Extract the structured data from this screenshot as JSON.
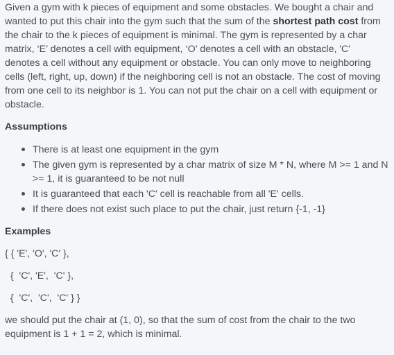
{
  "intro": {
    "part1": "Given a gym with k pieces of equipment and some obstacles.  We bought a chair and wanted to put this chair into the gym such that  the sum of the ",
    "bold": "shortest path cost",
    "part2": " from the chair to the k pieces of equipment is minimal. The gym is represented by a char matrix,  ‘E’  denotes a cell with equipment,  ‘O’  denotes a cell with an obstacle, 'C' denotes a cell without any equipment or obstacle. You can only move to neighboring cells (left, right, up, down) if the neighboring cell is not an obstacle. The cost of moving from one cell to its neighbor is 1. You can not put the chair on a cell with equipment or obstacle."
  },
  "assumptions": {
    "heading": "Assumptions",
    "items": [
      "There is at least one equipment in the gym",
      "The given gym is represented by a char matrix of size M * N, where M >= 1 and N >= 1, it is guaranteed to be not null",
      "It is guaranteed that each 'C' cell is reachable from all 'E' cells.",
      "If there does not exist such place to put the chair, just return {-1, -1}"
    ]
  },
  "examples": {
    "heading": "Examples",
    "lines": [
      "{ { 'E', 'O', 'C' },",
      "  {  'C', 'E',  'C' },",
      "  {  'C',  'C',  'C' } }"
    ],
    "conclusion": "we should put the chair at (1, 0), so that the sum of cost from the chair to the two equipment is 1 + 1 = 2, which is minimal."
  }
}
